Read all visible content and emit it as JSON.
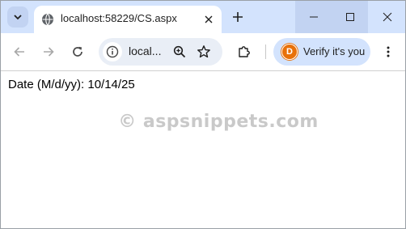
{
  "tab": {
    "title": "localhost:58229/CS.aspx",
    "favicon": "globe-icon"
  },
  "toolbar": {
    "url_display": "local...",
    "profile_chip": {
      "avatar_letter": "D",
      "avatar_color": "#e8710a",
      "label": "Verify it's you"
    }
  },
  "page": {
    "date_text": "Date (M/d/yy): 10/14/25",
    "watermark": "© aspsnippets.com"
  },
  "colors": {
    "tabstrip_bg": "#d3e3fd",
    "omnibox_bg": "#e9eef6",
    "watermark": "#c9c9c9"
  }
}
